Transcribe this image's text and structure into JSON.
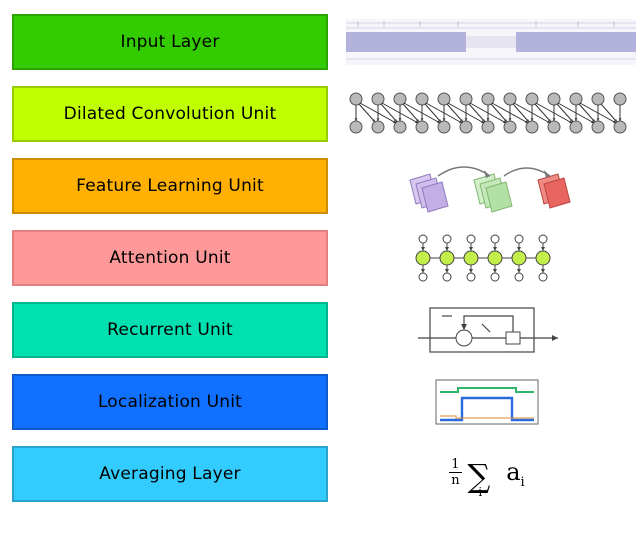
{
  "layers": [
    {
      "label": "Input Layer",
      "fill": "#33cc00",
      "border": "#2aa500"
    },
    {
      "label": "Dilated Convolution Unit",
      "fill": "#c0ff00",
      "border": "#99cc00"
    },
    {
      "label": "Feature Learning Unit",
      "fill": "#ffb000",
      "border": "#cc8e00"
    },
    {
      "label": "Attention Unit",
      "fill": "#ff9999",
      "border": "#e57f7f"
    },
    {
      "label": "Recurrent Unit",
      "fill": "#00e0b0",
      "border": "#00b48d"
    },
    {
      "label": "Localization Unit",
      "fill": "#1070ff",
      "border": "#0d5acc"
    },
    {
      "label": "Averaging Layer",
      "fill": "#33ccff",
      "border": "#29a3cc"
    }
  ],
  "formula": {
    "numer": "1",
    "denom": "n",
    "index": "i",
    "var": "a",
    "varsub": "i"
  }
}
